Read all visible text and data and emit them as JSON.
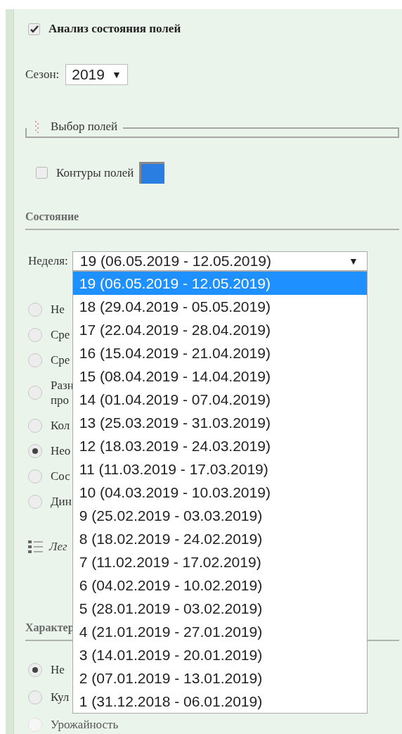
{
  "analysis": {
    "label": "Анализ состояния полей",
    "checked": true
  },
  "season": {
    "label": "Сезон:",
    "value": "2019",
    "arrow": "▼"
  },
  "field_selection": {
    "legend": "Выбор полей"
  },
  "contours": {
    "label": "Контуры полей",
    "checked": false,
    "color": "#2a7de1"
  },
  "state": {
    "heading": "Состояние",
    "week": {
      "label": "Неделя:",
      "value": "19 (06.05.2019 - 12.05.2019)",
      "arrow": "▼",
      "options": [
        {
          "label": "19 (06.05.2019 - 12.05.2019)",
          "selected": true
        },
        {
          "label": "18 (29.04.2019 - 05.05.2019)",
          "selected": false
        },
        {
          "label": "17 (22.04.2019 - 28.04.2019)",
          "selected": false
        },
        {
          "label": "16 (15.04.2019 - 21.04.2019)",
          "selected": false
        },
        {
          "label": "15 (08.04.2019 - 14.04.2019)",
          "selected": false
        },
        {
          "label": "14 (01.04.2019 - 07.04.2019)",
          "selected": false
        },
        {
          "label": "13 (25.03.2019 - 31.03.2019)",
          "selected": false
        },
        {
          "label": "12 (18.03.2019 - 24.03.2019)",
          "selected": false
        },
        {
          "label": "11 (11.03.2019 - 17.03.2019)",
          "selected": false
        },
        {
          "label": "10 (04.03.2019 - 10.03.2019)",
          "selected": false
        },
        {
          "label": "9 (25.02.2019 - 03.03.2019)",
          "selected": false
        },
        {
          "label": "8 (18.02.2019 - 24.02.2019)",
          "selected": false
        },
        {
          "label": "7 (11.02.2019 - 17.02.2019)",
          "selected": false
        },
        {
          "label": "6 (04.02.2019 - 10.02.2019)",
          "selected": false
        },
        {
          "label": "5 (28.01.2019 - 03.02.2019)",
          "selected": false
        },
        {
          "label": "4 (21.01.2019 - 27.01.2019)",
          "selected": false
        },
        {
          "label": "3 (14.01.2019 - 20.01.2019)",
          "selected": false
        },
        {
          "label": "2 (07.01.2019 - 13.01.2019)",
          "selected": false
        },
        {
          "label": "1 (31.12.2018 - 06.01.2019)",
          "selected": false
        }
      ]
    },
    "modes": [
      {
        "lines": [
          "Не"
        ],
        "selected": false
      },
      {
        "lines": [
          "Сре"
        ],
        "selected": false
      },
      {
        "lines": [
          "Сре"
        ],
        "selected": false
      },
      {
        "lines": [
          "Разн",
          "про"
        ],
        "selected": false
      },
      {
        "lines": [
          "Кол"
        ],
        "selected": false
      },
      {
        "lines": [
          "Нео"
        ],
        "selected": true
      },
      {
        "lines": [
          "Сос"
        ],
        "selected": false
      },
      {
        "lines": [
          "Дин"
        ],
        "selected": false
      }
    ],
    "legend": {
      "label": "Лег"
    }
  },
  "characteristic": {
    "heading": "Характер",
    "options": [
      {
        "label": "Не",
        "selected": true,
        "disabled": false
      },
      {
        "label": "Кул",
        "selected": false,
        "disabled": false
      },
      {
        "label": "Урожайность",
        "selected": false,
        "disabled": true
      }
    ]
  }
}
